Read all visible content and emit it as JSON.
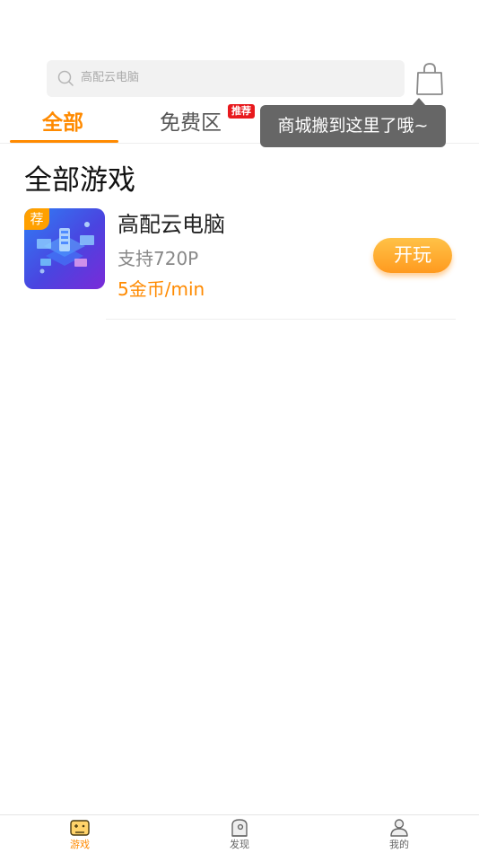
{
  "search": {
    "placeholder": "高配云电脑"
  },
  "tabs": [
    {
      "label": "全部",
      "active": true
    },
    {
      "label": "免费区",
      "badge": "推荐"
    }
  ],
  "tooltip": {
    "text": "商城搬到这里了哦~"
  },
  "section": {
    "title": "全部游戏"
  },
  "games": [
    {
      "badge": "荐",
      "name": "高配云电脑",
      "subtitle": "支持720P",
      "price": "5金币/min",
      "action": "开玩"
    }
  ],
  "bottom_nav": [
    {
      "label": "游戏",
      "icon": "gamepad-icon",
      "active": true
    },
    {
      "label": "发现",
      "icon": "discover-icon",
      "active": false
    },
    {
      "label": "我的",
      "icon": "profile-icon",
      "active": false
    }
  ],
  "colors": {
    "accent": "#ff8a00",
    "badge_red": "#e8191d",
    "tooltip_bg": "#666666"
  }
}
